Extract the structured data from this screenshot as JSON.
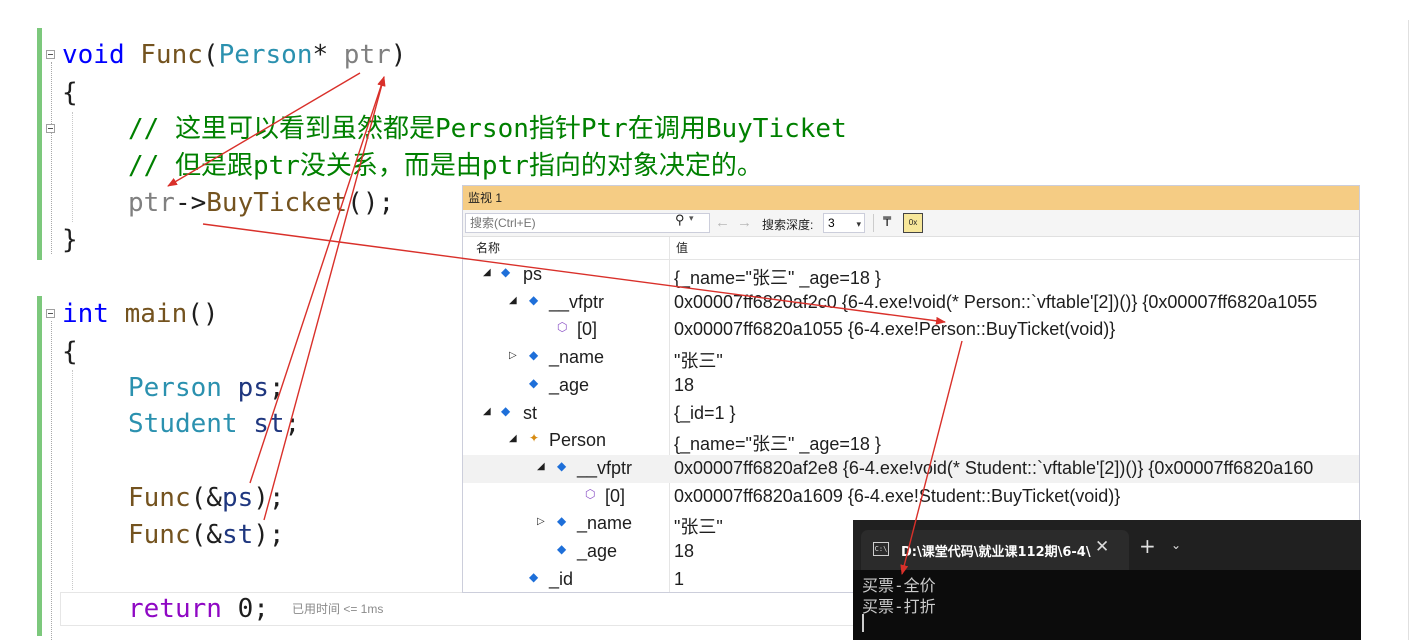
{
  "code": {
    "line1": {
      "kw": "void",
      "fn": "Func",
      "open": "(",
      "type": "Person",
      "star": "* ",
      "param": "ptr",
      "close": ")"
    },
    "line2": "{",
    "line3": "// 这里可以看到虽然都是Person指针Ptr在调用BuyTicket",
    "line4": "// 但是跟ptr没关系，而是由ptr指向的对象决定的。",
    "line5": {
      "obj": "ptr",
      "arrow": "->",
      "method": "BuyTicket",
      "rest": "();"
    },
    "line6": "}",
    "line8": {
      "kw": "int",
      "fn": "main",
      "rest": "()"
    },
    "line9": "{",
    "line10": {
      "type": "Person",
      "var": "ps",
      "semi": ";"
    },
    "line11": {
      "type": "Student",
      "var": "st",
      "semi": ";"
    },
    "line13": {
      "fn": "Func",
      "open": "(&",
      "var": "ps",
      "close": ");"
    },
    "line14": {
      "fn": "Func",
      "open": "(&",
      "var": "st",
      "close": ");"
    },
    "line16": {
      "kw": "return",
      "rest": " 0;"
    },
    "elapsed_hint": "已用时间 <= 1ms"
  },
  "watch": {
    "title": "监视 1",
    "search_placeholder": "搜索(Ctrl+E)",
    "depth_label": "搜索深度:",
    "depth_value": "3",
    "col_name": "名称",
    "col_value": "值",
    "rows": [
      {
        "name": "ps",
        "value": "{_name=\"张三\" _age=18 }"
      },
      {
        "name": "__vfptr",
        "value": "0x00007ff6820af2c0 {6-4.exe!void(* Person::`vftable'[2])()} {0x00007ff6820a1055"
      },
      {
        "name": "[0]",
        "value": "0x00007ff6820a1055 {6-4.exe!Person::BuyTicket(void)}"
      },
      {
        "name": "_name",
        "value": "\"张三\""
      },
      {
        "name": "_age",
        "value": "18"
      },
      {
        "name": "st",
        "value": "{_id=1 }"
      },
      {
        "name": "Person",
        "value": "{_name=\"张三\" _age=18 }"
      },
      {
        "name": "__vfptr",
        "value": "0x00007ff6820af2e8 {6-4.exe!void(* Student::`vftable'[2])()} {0x00007ff6820a160"
      },
      {
        "name": "[0]",
        "value": "0x00007ff6820a1609 {6-4.exe!Student::BuyTicket(void)}"
      },
      {
        "name": "_name",
        "value": "\"张三\""
      },
      {
        "name": "_age",
        "value": "18"
      },
      {
        "name": "_id",
        "value": "1"
      }
    ]
  },
  "terminal": {
    "tab_title": "D:\\课堂代码\\就业课112期\\6-4\\",
    "icon_text": "C:\\",
    "output": [
      "买票-全价",
      "买票-打折"
    ]
  },
  "colors": {
    "keyword": "#0000ff",
    "return_keyword": "#8f08c4",
    "type": "#2b91af",
    "function": "#74531f",
    "comment": "#008000",
    "annotation_arrow": "#d9302a",
    "watch_title_bg": "#f5cc84",
    "terminal_bg": "#0c0c0c"
  }
}
